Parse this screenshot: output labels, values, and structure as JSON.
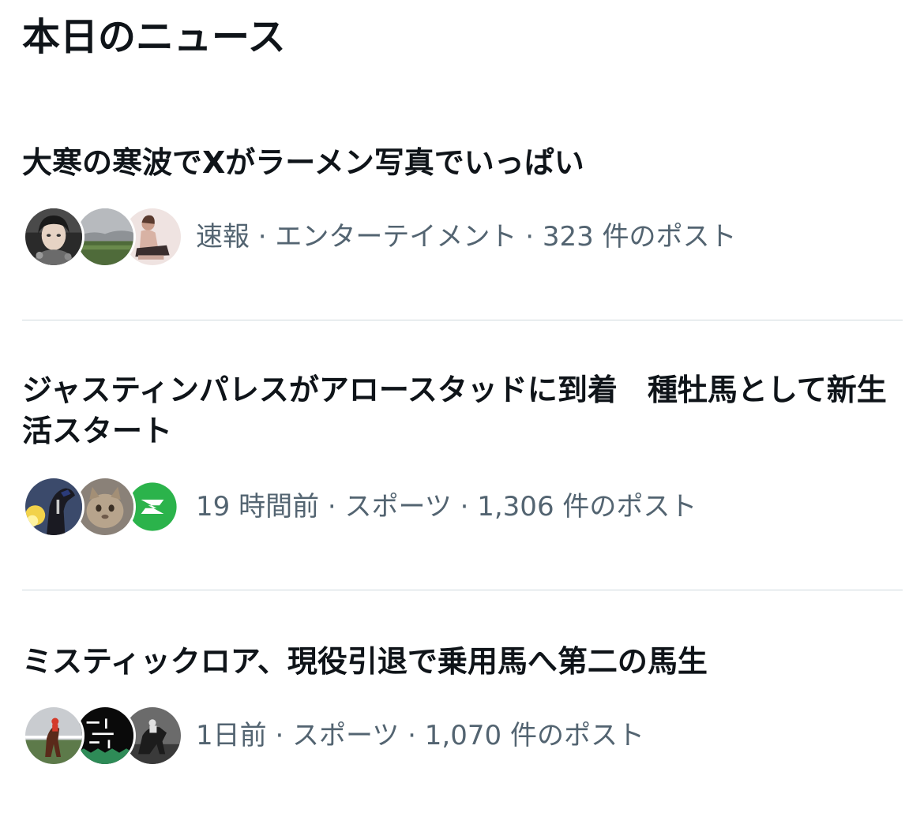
{
  "section": {
    "title": "本日のニュース"
  },
  "news": [
    {
      "headline": "大寒の寒波でXがラーメン写真でいっぱい",
      "meta": "速報 · エンターテイメント · 323 件のポスト",
      "avatars": [
        "avatar-user-girl",
        "avatar-user-field",
        "avatar-user-woman"
      ]
    },
    {
      "headline": "ジャスティンパレスがアロースタッドに到着　種牡馬として新生活スタート",
      "meta": "19 時間前 · スポーツ · 1,306 件のポスト",
      "avatars": [
        "avatar-user-horse",
        "avatar-user-cat",
        "avatar-user-logo-green"
      ]
    },
    {
      "headline": "ミスティックロア、現役引退で乗用馬へ第二の馬生",
      "meta": "1日前 · スポーツ · 1,070 件のポスト",
      "avatars": [
        "avatar-user-racehorse",
        "avatar-user-black-text",
        "avatar-user-jockey"
      ]
    }
  ],
  "colors": {
    "text_primary": "#0f1419",
    "text_secondary": "#536471",
    "divider": "#cfd9de",
    "background": "#ffffff",
    "logo_green": "#2bb34b"
  }
}
